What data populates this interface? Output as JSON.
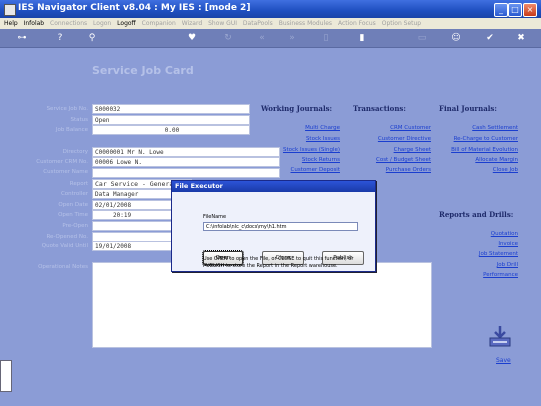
{
  "window": {
    "title": "IES Navigator Client v8.04 : My IES :     [mode 2]"
  },
  "menu": [
    "Help",
    "Infolab",
    "Connections",
    "Logon",
    "Logoff",
    "Companion",
    "Wizard",
    "Show GUI",
    "DataPools",
    "Business Modules",
    "Action Focus",
    "Option Setup"
  ],
  "form": {
    "title": "Service Job Card",
    "fields": [
      {
        "label": "Service Job No.",
        "value": "S000032"
      },
      {
        "label": "Status",
        "value": "Open"
      },
      {
        "label": "Job Balance",
        "value": "0.00"
      },
      {
        "label": "Directory",
        "value": "C0000001 Mr N. Lowe"
      },
      {
        "label": "Customer CRM No.",
        "value": "00006 Lowe N."
      },
      {
        "label": "Customer Name",
        "value": ""
      },
      {
        "label": "Report",
        "value": "Car Service - General"
      },
      {
        "label": "Controller",
        "value": "Data Manager"
      },
      {
        "label": "Open Date",
        "value": "02/01/2008"
      },
      {
        "label": "Open Time",
        "value": "20:19"
      },
      {
        "label": "Pre-Open",
        "value": ""
      },
      {
        "label": "Re-Opened No.",
        "value": ""
      },
      {
        "label": "Quote Valid Until",
        "value": "19/01/2008"
      },
      {
        "label": "Operational Notes",
        "value": ""
      }
    ]
  },
  "columns": {
    "working": {
      "title": "Working Journals:",
      "links": [
        "Multi Charge",
        "Stock Issues",
        "Stock Issues (Single)",
        "Stock Returns",
        "Customer Deposit"
      ]
    },
    "transactions": {
      "title": "Transactions:",
      "links": [
        "CRM Customer",
        "Customer Directive",
        "Charge Sheet",
        "Cost / Budget Sheet",
        "Purchase Orders"
      ]
    },
    "final": {
      "title": "Final Journals:",
      "links": [
        "Cash Settlement",
        "Re-Charge to Customer",
        "Bill of Material Evolution",
        "Allocate Margin",
        "Close Job"
      ]
    },
    "reports": {
      "title": "Reports and Drills:",
      "links": [
        "Quotation",
        "Invoice",
        "Job Statement",
        "Job Drill",
        "Performance"
      ]
    }
  },
  "save_label": "Save",
  "dialog": {
    "title": "File Executor",
    "filename_label": "FileName",
    "filename_value": "C:\\infolab\\nlc_c\\docs\\my\\h1.htm",
    "buttons": {
      "open": "Open",
      "close": "Close",
      "publish": "Publish"
    },
    "hint_line1": "Use OPEN to open the File, or CLOSE to quit this function, or",
    "hint_line2": "PUBLISH to store the Report in the Report warehouse."
  }
}
